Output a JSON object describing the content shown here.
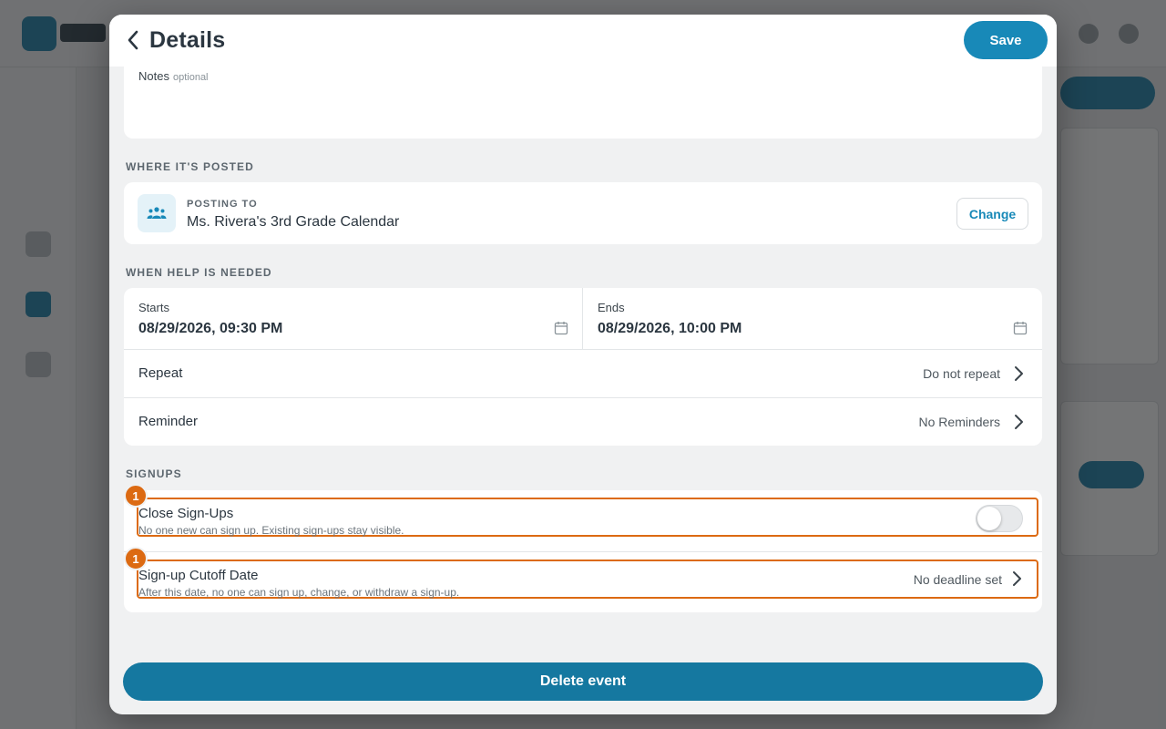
{
  "header": {
    "title": "Details",
    "save_label": "Save"
  },
  "notes": {
    "label": "Notes",
    "optional": "optional"
  },
  "posted": {
    "section_label": "WHERE IT'S POSTED",
    "kicker": "POSTING TO",
    "calendar_name": "Ms. Rivera's 3rd Grade Calendar",
    "change_label": "Change",
    "icon": "group-icon"
  },
  "when": {
    "section_label": "WHEN HELP IS NEEDED",
    "starts_label": "Starts",
    "starts_value": "08/29/2026, 09:30 PM",
    "ends_label": "Ends",
    "ends_value": "08/29/2026, 10:00 PM",
    "repeat_label": "Repeat",
    "repeat_value": "Do not repeat",
    "reminder_label": "Reminder",
    "reminder_value": "No Reminders"
  },
  "signups": {
    "section_label": "SIGNUPS",
    "close_title": "Close Sign-Ups",
    "close_sub": "No one new can sign up. Existing sign-ups stay visible.",
    "close_toggle_on": false,
    "cutoff_title": "Sign-up Cutoff Date",
    "cutoff_sub": "After this date, no one can sign up, change, or withdraw a sign-up.",
    "cutoff_value": "No deadline set",
    "badge_1": "1",
    "badge_2": "1"
  },
  "footer": {
    "delete_label": "Delete event"
  },
  "colors": {
    "accent": "#1889b8",
    "delete": "#1578a0",
    "highlight": "#dc6a12"
  }
}
